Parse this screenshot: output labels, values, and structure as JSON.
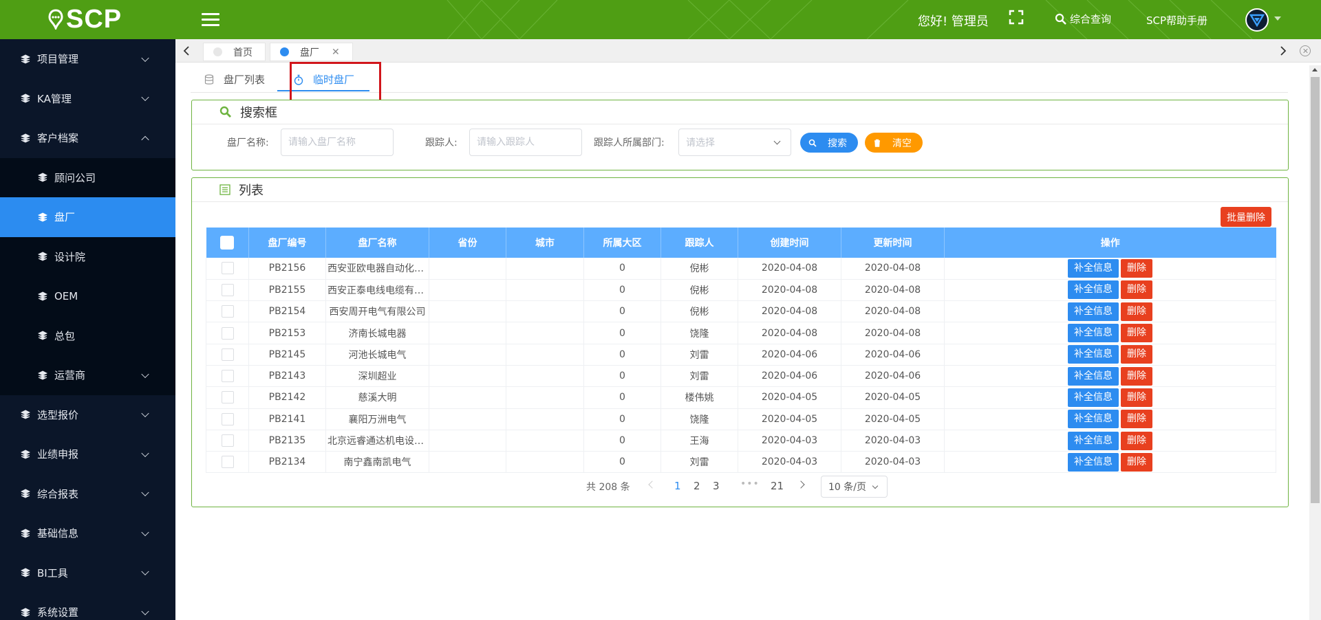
{
  "header": {
    "logo_text": "SCP",
    "greeting": "您好! 管理员",
    "query_label": "综合查询",
    "help_label": "SCP帮助手册",
    "brand_color": "#4f9e14"
  },
  "sidebar": {
    "items": [
      {
        "label": "项目管理"
      },
      {
        "label": "KA管理"
      },
      {
        "label": "客户档案"
      },
      {
        "label": "选型报价"
      },
      {
        "label": "业绩申报"
      },
      {
        "label": "综合报表"
      },
      {
        "label": "基础信息"
      },
      {
        "label": "BI工具"
      },
      {
        "label": "系统设置"
      }
    ],
    "sub_items": [
      {
        "label": "顾问公司"
      },
      {
        "label": "盘厂"
      },
      {
        "label": "设计院"
      },
      {
        "label": "OEM"
      },
      {
        "label": "总包"
      },
      {
        "label": "运营商"
      }
    ],
    "active_color": "#2c8cf0"
  },
  "tabs": [
    {
      "label": "首页"
    },
    {
      "label": "盘厂"
    }
  ],
  "subtabs": [
    {
      "label": "盘厂列表"
    },
    {
      "label": "临时盘厂"
    }
  ],
  "search": {
    "title": "搜索框",
    "name_label": "盘厂名称:",
    "name_placeholder": "请输入盘厂名称",
    "follower_label": "跟踪人:",
    "follower_placeholder": "请输入跟踪人",
    "dept_label": "跟踪人所属部门:",
    "dept_placeholder": "请选择",
    "search_button": "搜索",
    "clear_button": "清空"
  },
  "list": {
    "title": "列表",
    "batch_delete": "批量删除",
    "columns": [
      "盘厂编号",
      "盘厂名称",
      "省份",
      "城市",
      "所属大区",
      "跟踪人",
      "创建时间",
      "更新时间",
      "操作"
    ],
    "supplement_label": "补全信息",
    "delete_label": "删除",
    "rows": [
      [
        "PB2156",
        "西安亚欧电器自动化有限公司",
        "",
        "",
        "0",
        "倪彬",
        "2020-04-08",
        "2020-04-08"
      ],
      [
        "PB2155",
        "西安正泰电线电缆有限公司",
        "",
        "",
        "0",
        "倪彬",
        "2020-04-08",
        "2020-04-08"
      ],
      [
        "PB2154",
        "西安周开电气有限公司",
        "",
        "",
        "0",
        "倪彬",
        "2020-04-08",
        "2020-04-08"
      ],
      [
        "PB2153",
        "济南长城电器",
        "",
        "",
        "0",
        "饶隆",
        "2020-04-08",
        "2020-04-08"
      ],
      [
        "PB2145",
        "河池长城电气",
        "",
        "",
        "0",
        "刘雷",
        "2020-04-06",
        "2020-04-06"
      ],
      [
        "PB2143",
        "深圳超业",
        "",
        "",
        "0",
        "刘雷",
        "2020-04-06",
        "2020-04-06"
      ],
      [
        "PB2142",
        "慈溪大明",
        "",
        "",
        "0",
        "楼伟姚",
        "2020-04-05",
        "2020-04-05"
      ],
      [
        "PB2141",
        "襄阳万洲电气",
        "",
        "",
        "0",
        "饶隆",
        "2020-04-05",
        "2020-04-05"
      ],
      [
        "PB2135",
        "北京远睿通达机电设备有限公司",
        "",
        "",
        "0",
        "王海",
        "2020-04-03",
        "2020-04-03"
      ],
      [
        "PB2134",
        "南宁鑫南凯电气",
        "",
        "",
        "0",
        "刘雷",
        "2020-04-03",
        "2020-04-03"
      ]
    ]
  },
  "pager": {
    "total": "共 208 条",
    "pages": [
      "1",
      "2",
      "3"
    ],
    "dots": "•••",
    "last_page": "21",
    "page_size": "10 条/页"
  }
}
